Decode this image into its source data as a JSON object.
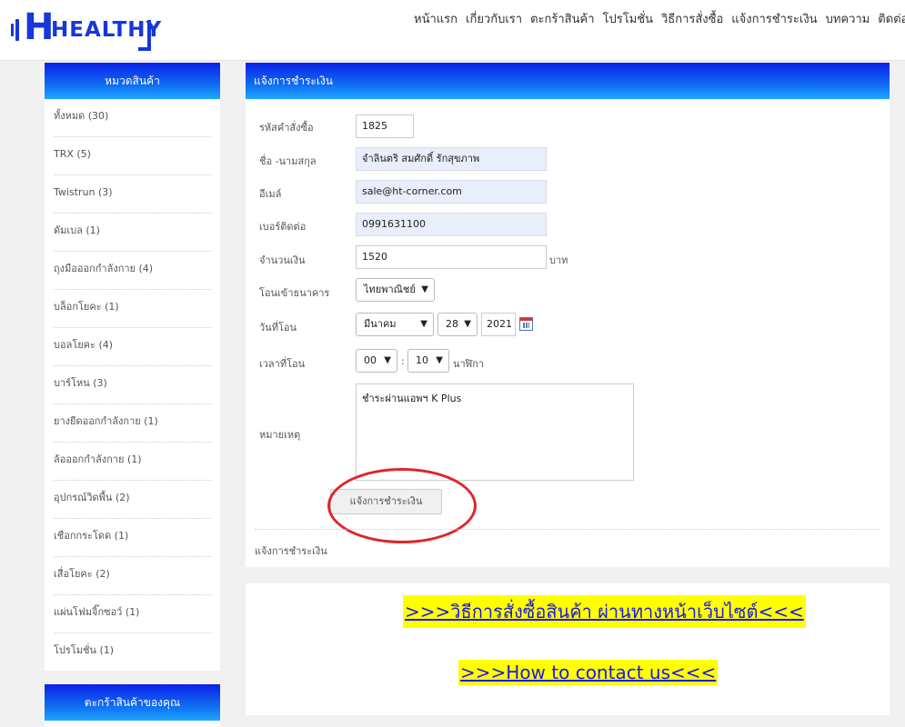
{
  "brand": {
    "logo_text": "HEALTHY"
  },
  "nav": [
    "หน้าแรก",
    "เกี่ยวกับเรา",
    "ตะกร้าสินค้า",
    "โปรโมชั่น",
    "วิธีการสั่งซื้อ",
    "แจ้งการชำระเงิน",
    "บทความ",
    "ติดต่อ"
  ],
  "sidebar": {
    "category_title": "หมวดสินค้า",
    "categories": [
      "ทั้งหมด (30)",
      "TRX (5)",
      "Twistrun (3)",
      "ดัมเบล (1)",
      "ถุงมือออกกำลังกาย (4)",
      "บล็อกโยคะ (1)",
      "บอลโยคะ (4)",
      "บาร์โหน (3)",
      "ยางยืดออกกำลังกาย (1)",
      "ล้อออกกำลังกาย (1)",
      "อุปกรณ์วิดพื้น (2)",
      "เชือกกระโดด (1)",
      "เสื่อโยคะ (2)",
      "แผ่นโฟมจิ๊กซอว์ (1)",
      "โปรโมชั่น (1)"
    ],
    "cart_title": "ตะกร้าสินค้าของคุณ"
  },
  "form": {
    "title": "แจ้งการชำระเงิน",
    "order_label": "รหัสคำสั่งซื้อ",
    "order_value": "1825",
    "name_label": "ชื่อ -นามสกุล",
    "name_value": "จำลินตริ สมศักดิ์ รักสุขภาพ",
    "email_label": "อีเมล์",
    "email_value": "sale@ht-corner.com",
    "phone_label": "เบอร์ติดต่อ",
    "phone_value": "0991631100",
    "amount_label": "จำนวนเงิน",
    "amount_value": "1520",
    "amount_unit": "บาท",
    "bank_label": "โอนเข้าธนาคาร",
    "bank_value": "ไทยพาณิชย์",
    "date_label": "วันที่โอน",
    "date_month": "มีนาคม",
    "date_day": "28",
    "date_year": "2021",
    "time_label": "เวลาที่โอน",
    "time_hour": "00",
    "time_sep": ":",
    "time_minute": "10",
    "time_unit": "นาฬิกา",
    "note_label": "หมายเหตุ",
    "note_value": "ชำระผ่านแอพฯ K Plus",
    "submit_label": "แจ้งการชำระเงิน",
    "footer_text": "แจ้งการชำระเงิน"
  },
  "links": {
    "how_to_order": ">>>วิธีการสั่งซื้อสินค้า ผ่านทางหน้าเว็บไซต์<<<",
    "contact": ">>>How to contact us<<<"
  },
  "colors": {
    "brand_blue": "#1737d8",
    "highlight": "#ffff00",
    "annotation_red": "#e0242a"
  }
}
